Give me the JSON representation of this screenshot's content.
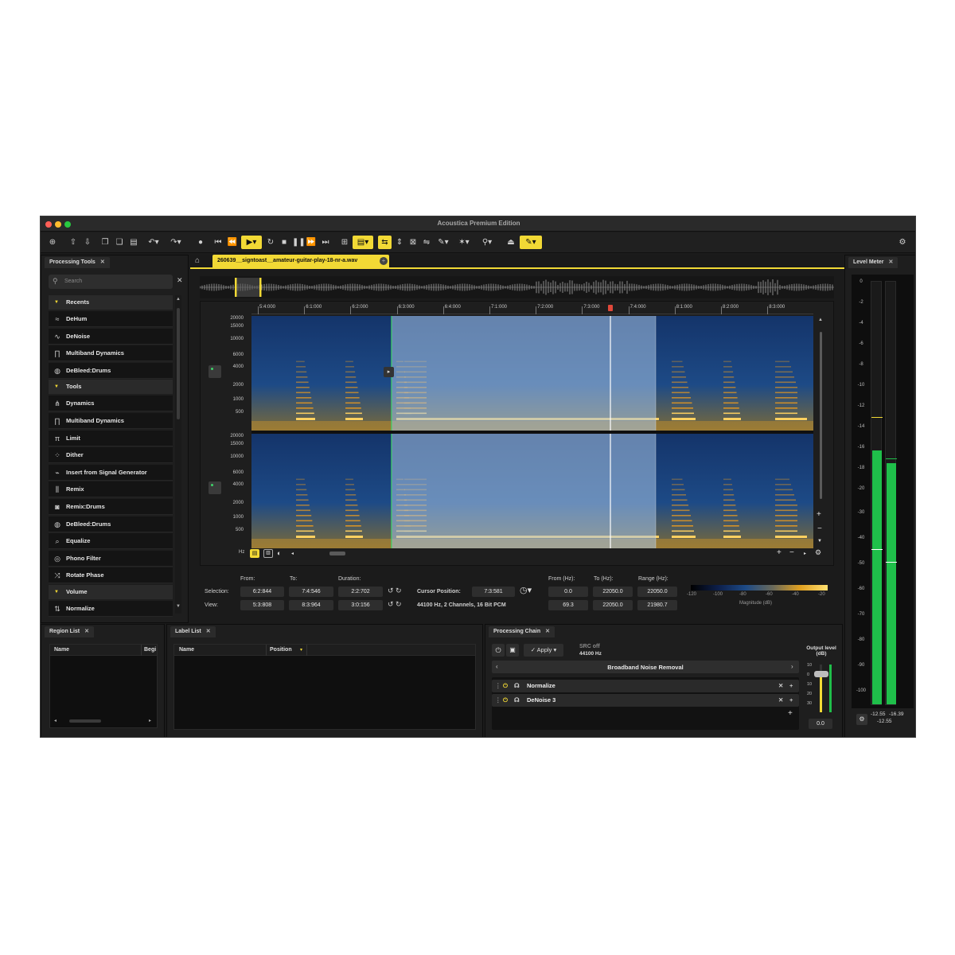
{
  "window": {
    "title": "Acoustica Premium Edition"
  },
  "colors": {
    "accent": "#f2d935",
    "meter_green": "#1fbf4a",
    "spectrogram_blue": "#1c3a6e",
    "spectrogram_orange": "#f0a020",
    "selection": "#7a9cc6"
  },
  "toolbar": {
    "icons": [
      "add-icon",
      "export-icon",
      "save-icon",
      "copy-icon",
      "paste-icon",
      "duplicate-icon",
      "undo-icon",
      "redo-icon",
      "record-icon",
      "skip-start-icon",
      "rewind-icon",
      "play-icon",
      "loop-icon",
      "stop-icon",
      "pause-icon",
      "fast-forward-icon",
      "skip-end-icon",
      "view-mode-icon",
      "spectrogram-view-icon",
      "snap-icon",
      "select-icon",
      "harmonic-select-icon",
      "lasso-icon",
      "brush-icon",
      "magic-wand-icon",
      "zoom-icon",
      "fit-icon",
      "pencil-icon",
      "settings-icon"
    ]
  },
  "processing_tools": {
    "tab": "Processing Tools",
    "search_placeholder": "Search",
    "sections": [
      {
        "label": "Recents",
        "items": [
          "DeHum",
          "DeNoise",
          "Multiband Dynamics",
          "DeBleed:Drums"
        ]
      },
      {
        "label": "Tools",
        "items": [
          "Dynamics",
          "Multiband Dynamics",
          "Limit",
          "Dither",
          "Insert from Signal Generator",
          "Remix",
          "Remix:Drums",
          "DeBleed:Drums",
          "Equalize",
          "Phono Filter",
          "Rotate Phase"
        ]
      },
      {
        "label": "Volume",
        "items": [
          "Normalize"
        ]
      }
    ]
  },
  "document": {
    "tab": "260639__signtoast__amateur-guitar-play-18-nr-a.wav"
  },
  "timeline": {
    "ticks": [
      "5:4:000",
      "6:1:000",
      "6:2:000",
      "6:3:000",
      "6:4:000",
      "7:1:000",
      "7:2:000",
      "7:3:000",
      "7:4:000",
      "8:1:000",
      "8:2:000",
      "8:3:000"
    ]
  },
  "freq_axis": {
    "labels": [
      "20000",
      "15000",
      "10000",
      "6000",
      "4000",
      "2000",
      "1000",
      "500"
    ],
    "unit": "Hz"
  },
  "selection_panel": {
    "headers": {
      "from": "From:",
      "to": "To:",
      "duration": "Duration:"
    },
    "selection": {
      "label": "Selection:",
      "from": "6:2:844",
      "to": "7:4:546",
      "duration": "2:2:702"
    },
    "view": {
      "label": "View:",
      "from": "5:3:808",
      "to": "8:3:964",
      "duration": "3:0:156"
    },
    "cursor": {
      "label": "Cursor Position:",
      "value": "7:3:581"
    },
    "format": "44100 Hz, 2 Channels, 16 Bit PCM",
    "freq_headers": {
      "from": "From (Hz):",
      "to": "To (Hz):",
      "range": "Range (Hz):"
    },
    "freq_selection": {
      "from": "0.0",
      "to": "22050.0",
      "range": "22050.0"
    },
    "freq_view": {
      "from": "69.3",
      "to": "22050.0",
      "range": "21980.7"
    },
    "magnitude": {
      "ticks": [
        "-120",
        "-100",
        "-80",
        "-60",
        "-40",
        "-20"
      ],
      "label": "Magnitude (dB)"
    }
  },
  "region_list": {
    "tab": "Region List",
    "columns": [
      "Name",
      "Begi"
    ]
  },
  "label_list": {
    "tab": "Label List",
    "columns": [
      "Name",
      "Position"
    ]
  },
  "processing_chain": {
    "tab": "Processing Chain",
    "apply_label": "Apply",
    "src_status": "SRC off",
    "src_rate": "44100 Hz",
    "preset": "Broadband Noise Removal",
    "items": [
      "Normalize",
      "DeNoise 3"
    ],
    "output_label": "Output level (dB)",
    "output_ticks": [
      "10",
      "0",
      "10",
      "20",
      "30"
    ],
    "output_value": "0.0"
  },
  "level_meter": {
    "tab": "Level Meter",
    "scale": [
      "0",
      "-2",
      "-4",
      "-6",
      "-8",
      "-10",
      "-12",
      "-14",
      "-16",
      "-18",
      "-20",
      "-30",
      "-40",
      "-50",
      "-60",
      "-70",
      "-80",
      "-90",
      "-100"
    ],
    "left_peak": "-12.55",
    "right_peak": "-16.39",
    "bottom_value": "-12.55",
    "left_level": 0.6,
    "right_level": 0.57
  }
}
